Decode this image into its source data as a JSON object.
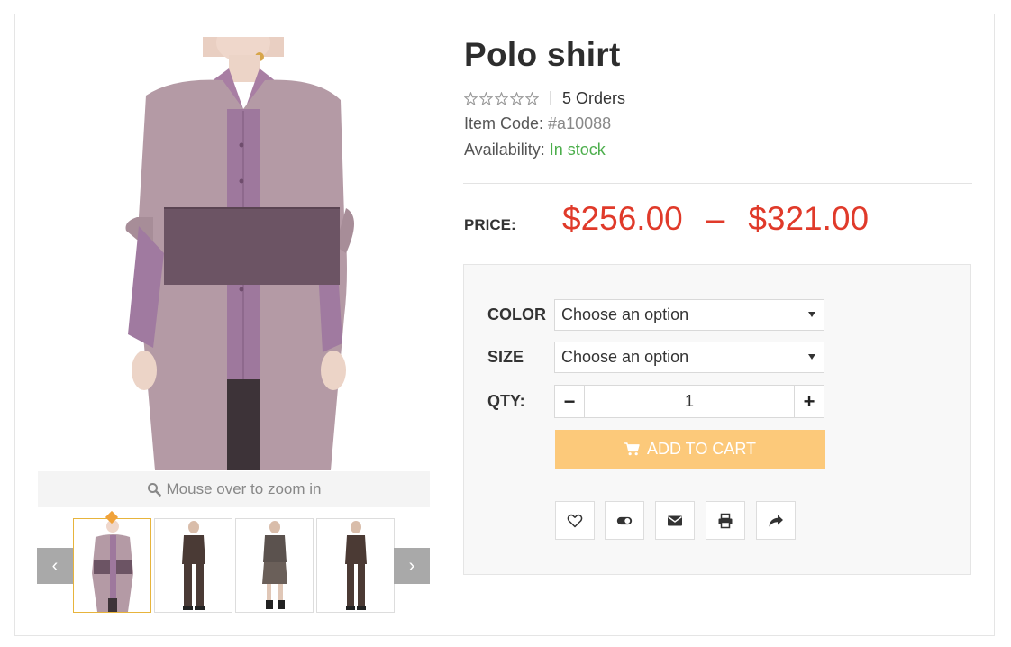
{
  "gallery": {
    "zoom_hint": "Mouse over to zoom in",
    "prev_label": "‹",
    "next_label": "›",
    "thumbnails": [
      {
        "name": "thumb-lilac-coat",
        "active": true
      },
      {
        "name": "thumb-brown-suit-pants",
        "active": false
      },
      {
        "name": "thumb-gray-suit-skirt",
        "active": false
      },
      {
        "name": "thumb-brown-jumpsuit",
        "active": false
      }
    ]
  },
  "product": {
    "title": "Polo shirt",
    "rating_stars": 0,
    "orders": "5 Orders",
    "item_code_label": "Item Code: ",
    "item_code": "#a10088",
    "availability_label": "Availability: ",
    "availability": "In stock",
    "price_label": "PRICE:",
    "price_min": "$256.00",
    "price_dash": "–",
    "price_max": "$321.00"
  },
  "options": {
    "color_label": "COLOR",
    "color_value": "Choose an option",
    "size_label": "SIZE",
    "size_value": "Choose an option",
    "qty_label": "QTY:",
    "qty_minus": "−",
    "qty_value": "1",
    "qty_plus": "+",
    "add_to_cart": "ADD TO CART"
  },
  "actions": [
    "heart-icon",
    "toggle-compare-icon",
    "envelope-icon",
    "print-icon",
    "share-icon"
  ],
  "colors": {
    "price": "#e03a2a",
    "in_stock": "#4cae4c",
    "cart_button": "#fcc97a",
    "thumb_active_border": "#e7b43c"
  }
}
